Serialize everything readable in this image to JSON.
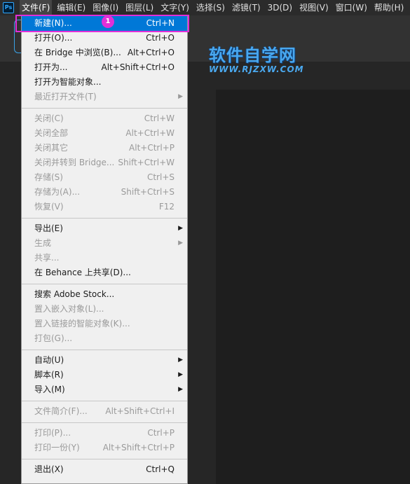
{
  "menubar": {
    "logo": "Ps",
    "menus": [
      "文件(F)",
      "编辑(E)",
      "图像(I)",
      "图层(L)",
      "文字(Y)",
      "选择(S)",
      "滤镜(T)",
      "3D(D)",
      "视图(V)",
      "窗口(W)",
      "帮助(H)"
    ]
  },
  "watermark": {
    "title": "软件自学网",
    "url": "WWW.RJZXW.COM"
  },
  "annotation": {
    "badge": "1"
  },
  "file_menu": {
    "items": [
      {
        "label": "新建(N)...",
        "shortcut": "Ctrl+N"
      },
      {
        "label": "打开(O)...",
        "shortcut": "Ctrl+O"
      },
      {
        "label": "在 Bridge 中浏览(B)...",
        "shortcut": "Alt+Ctrl+O"
      },
      {
        "label": "打开为...",
        "shortcut": "Alt+Shift+Ctrl+O"
      },
      {
        "label": "打开为智能对象...",
        "shortcut": ""
      },
      {
        "label": "最近打开文件(T)",
        "shortcut": ""
      },
      {
        "label": "关闭(C)",
        "shortcut": "Ctrl+W"
      },
      {
        "label": "关闭全部",
        "shortcut": "Alt+Ctrl+W"
      },
      {
        "label": "关闭其它",
        "shortcut": "Alt+Ctrl+P"
      },
      {
        "label": "关闭并转到 Bridge...",
        "shortcut": "Shift+Ctrl+W"
      },
      {
        "label": "存储(S)",
        "shortcut": "Ctrl+S"
      },
      {
        "label": "存储为(A)...",
        "shortcut": "Shift+Ctrl+S"
      },
      {
        "label": "恢复(V)",
        "shortcut": "F12"
      },
      {
        "label": "导出(E)",
        "shortcut": ""
      },
      {
        "label": "生成",
        "shortcut": ""
      },
      {
        "label": "共享...",
        "shortcut": ""
      },
      {
        "label": "在 Behance 上共享(D)...",
        "shortcut": ""
      },
      {
        "label": "搜索 Adobe Stock...",
        "shortcut": ""
      },
      {
        "label": "置入嵌入对象(L)...",
        "shortcut": ""
      },
      {
        "label": "置入链接的智能对象(K)...",
        "shortcut": ""
      },
      {
        "label": "打包(G)...",
        "shortcut": ""
      },
      {
        "label": "自动(U)",
        "shortcut": ""
      },
      {
        "label": "脚本(R)",
        "shortcut": ""
      },
      {
        "label": "导入(M)",
        "shortcut": ""
      },
      {
        "label": "文件简介(F)...",
        "shortcut": "Alt+Shift+Ctrl+I"
      },
      {
        "label": "打印(P)...",
        "shortcut": "Ctrl+P"
      },
      {
        "label": "打印一份(Y)",
        "shortcut": "Alt+Shift+Ctrl+P"
      },
      {
        "label": "退出(X)",
        "shortcut": "Ctrl+Q"
      }
    ]
  }
}
